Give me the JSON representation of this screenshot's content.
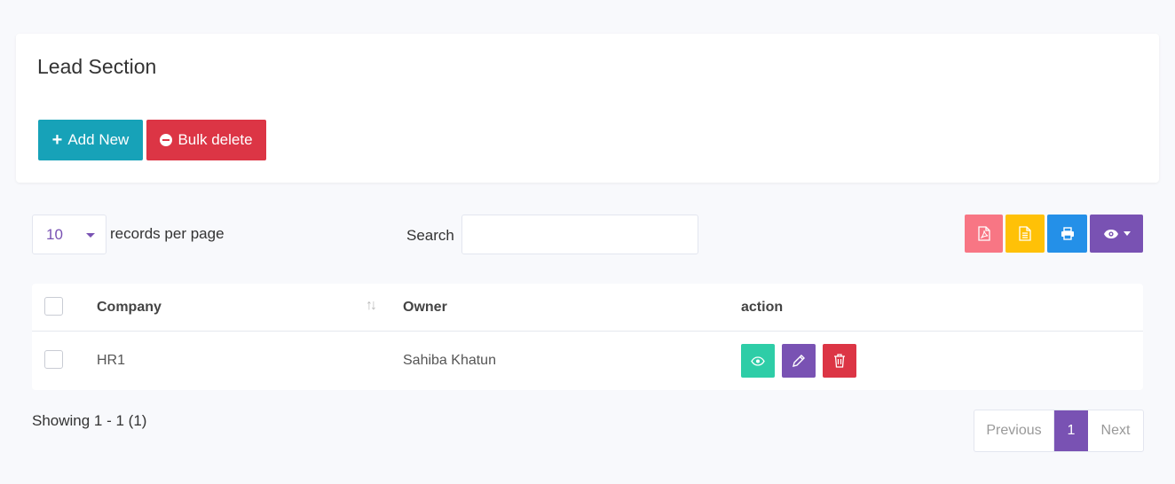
{
  "section": {
    "title": "Lead Section",
    "add_label": "Add New",
    "bulk_delete_label": "Bulk delete"
  },
  "controls": {
    "per_page_value": "10",
    "per_page_label": "records per page",
    "search_label": "Search",
    "search_value": "",
    "toolbar_icons": [
      "pdf-icon",
      "document-icon",
      "print-icon",
      "eye-icon"
    ]
  },
  "table": {
    "columns": [
      "Company",
      "Owner",
      "action"
    ],
    "rows": [
      {
        "company": "HR1",
        "owner": "Sahiba Khatun"
      }
    ]
  },
  "footer": {
    "showing": "Showing 1 - 1 (1)",
    "previous": "Previous",
    "page": "1",
    "next": "Next"
  },
  "colors": {
    "accent": "#7952b3",
    "add": "#17a2b8",
    "danger": "#dc3545",
    "pdf": "#f87684",
    "doc": "#ffc107",
    "print": "#2490e8",
    "view": "#2ecda7"
  }
}
